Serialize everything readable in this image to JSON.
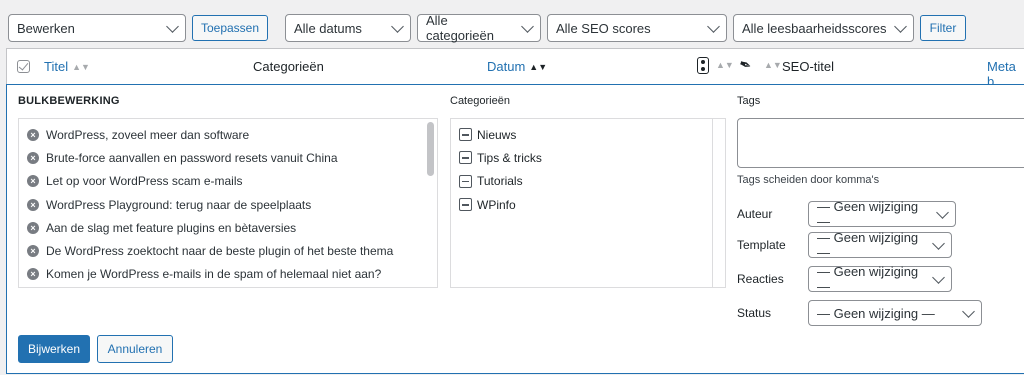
{
  "filters": {
    "bulk_action": "Bewerken",
    "apply": "Toepassen",
    "dates": "Alle datums",
    "categories": "Alle categorieën",
    "seo_scores": "Alle SEO scores",
    "readability": "Alle leesbaarheidsscores",
    "filter": "Filter"
  },
  "columns": {
    "title": "Titel",
    "categories": "Categorieën",
    "date": "Datum",
    "seo_title": "SEO-titel",
    "meta": "Meta b"
  },
  "bulk": {
    "heading": "BULKBEWERKING",
    "posts": [
      "WordPress, zoveel meer dan software",
      "Brute-force aanvallen en password resets vanuit China",
      "Let op voor WordPress scam e-mails",
      "WordPress Playground: terug naar de speelplaats",
      "Aan de slag met feature plugins en bètaversies",
      "De WordPress zoektocht naar de beste plugin of het beste thema",
      "Komen je WordPress e-mails in de spam of helemaal niet aan?"
    ],
    "categories_label": "Categorieën",
    "categories": [
      "Nieuws",
      "Tips & tricks",
      "Tutorials",
      "WPinfo"
    ],
    "tags_label": "Tags",
    "tags_hint": "Tags scheiden door komma's",
    "fields": [
      {
        "label": "Auteur",
        "value": "— Geen wijziging —"
      },
      {
        "label": "Template",
        "value": "— Geen wijziging —"
      },
      {
        "label": "Reacties",
        "value": "— Geen wijziging —"
      },
      {
        "label": "Status",
        "value": "— Geen wijziging —"
      }
    ],
    "update": "Bijwerken",
    "cancel": "Annuleren"
  }
}
